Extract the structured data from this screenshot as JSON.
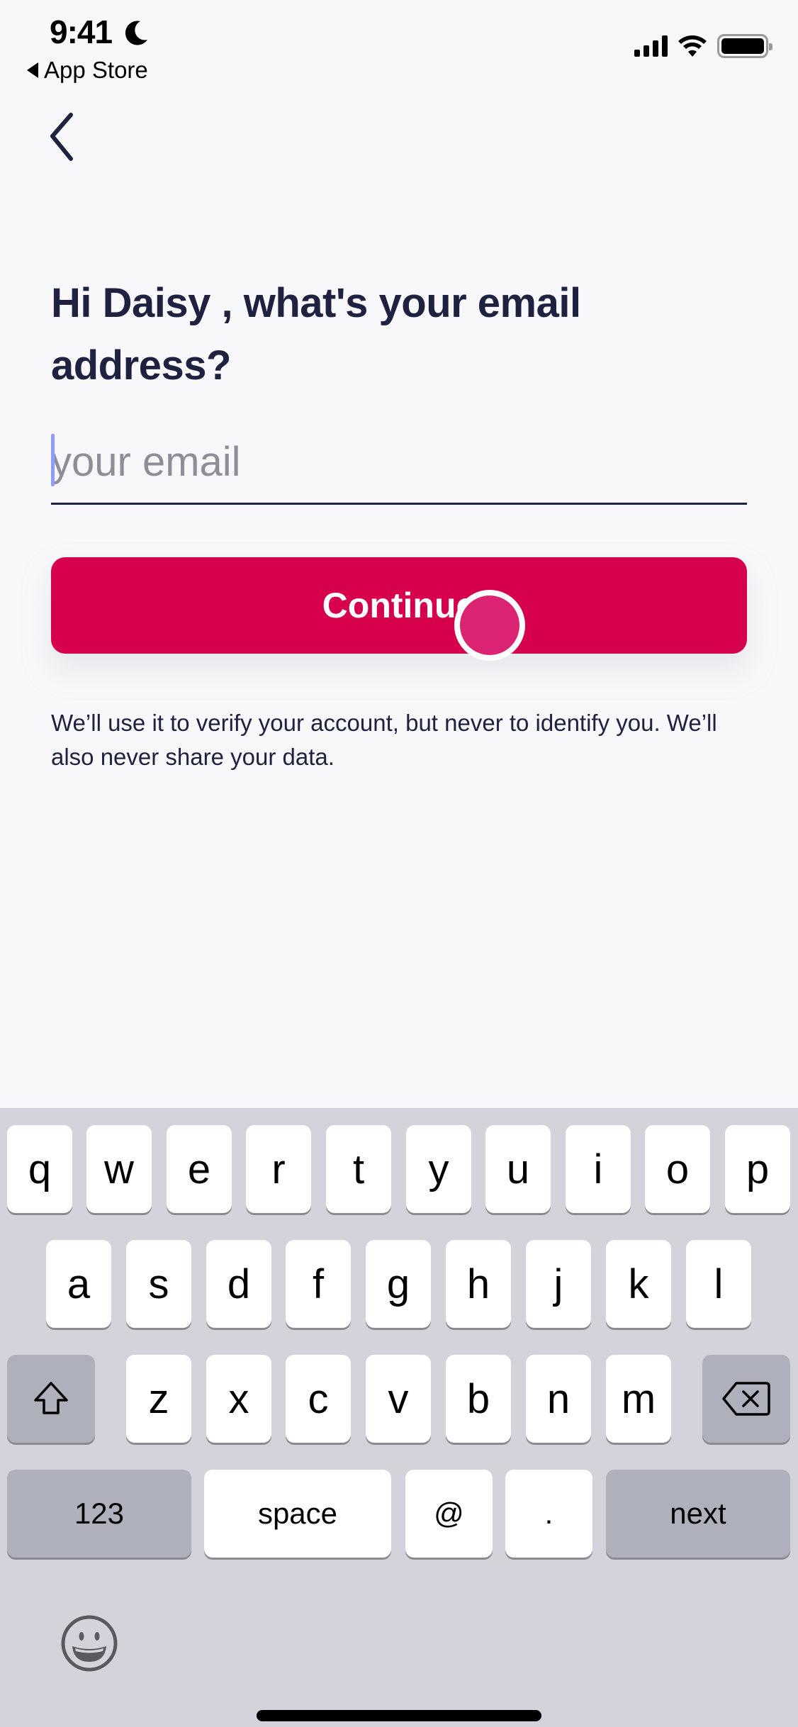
{
  "status_bar": {
    "time": "9:41",
    "back_app_label": "App Store",
    "icons": [
      "moon-icon",
      "cellular-signal-icon",
      "wifi-icon",
      "battery-icon"
    ]
  },
  "nav": {
    "back_icon": "chevron-left-icon"
  },
  "heading": "Hi Daisy , what's your email address?",
  "email_input": {
    "value": "",
    "placeholder": "your email"
  },
  "continue_button": {
    "label": "Continue",
    "color": "#D6004C"
  },
  "helper_text": "We’ll use it to verify your account, but never to identify you. We’ll also never share your data.",
  "keyboard": {
    "row1": [
      "q",
      "w",
      "e",
      "r",
      "t",
      "y",
      "u",
      "i",
      "o",
      "p"
    ],
    "row2": [
      "a",
      "s",
      "d",
      "f",
      "g",
      "h",
      "j",
      "k",
      "l"
    ],
    "row3": [
      "z",
      "x",
      "c",
      "v",
      "b",
      "n",
      "m"
    ],
    "shift_icon": "shift-icon",
    "delete_icon": "delete-backspace-icon",
    "numbers_label": "123",
    "space_label": "space",
    "at_label": "@",
    "dot_label": ".",
    "next_label": "next",
    "emoji_icon": "emoji-icon"
  }
}
